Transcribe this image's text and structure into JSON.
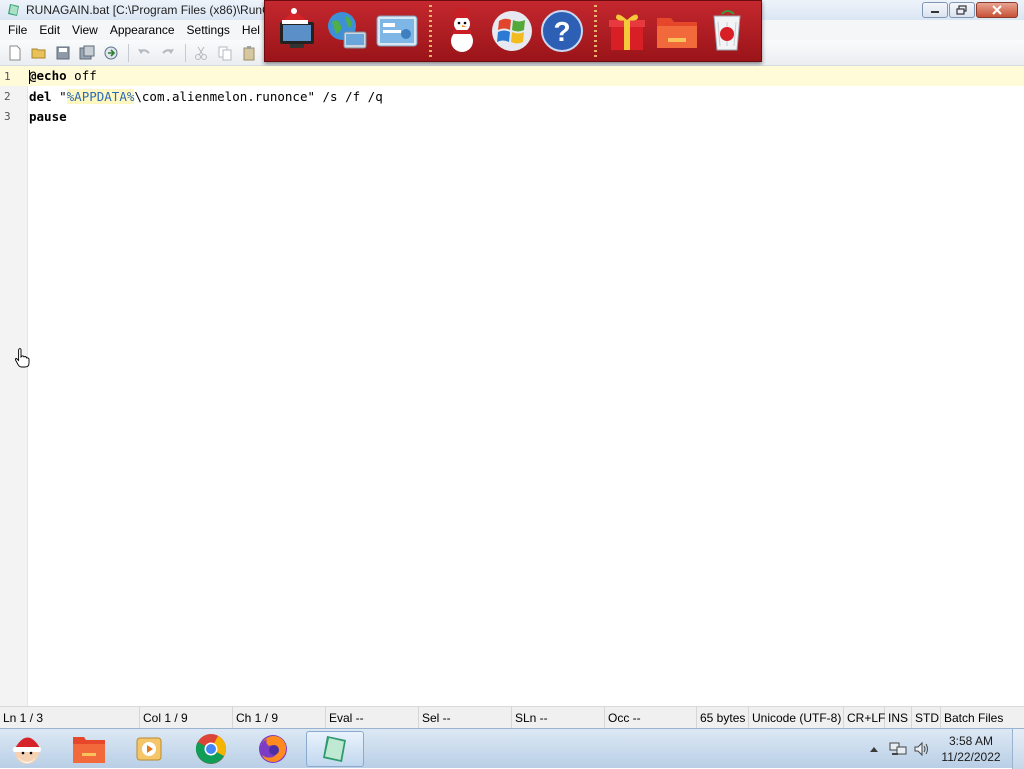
{
  "window": {
    "title": "RUNAGAIN.bat [C:\\Program Files (x86)\\RunO"
  },
  "menu": [
    "File",
    "Edit",
    "View",
    "Appearance",
    "Settings",
    "Hel"
  ],
  "toolbar": {
    "buttons": [
      "new-file-icon",
      "open-folder-icon",
      "save-icon",
      "save-as-icon",
      "browse-icon",
      "undo-icon",
      "redo-icon",
      "cut-icon",
      "copy-icon",
      "paste-icon"
    ]
  },
  "dock": {
    "icons": [
      "santa-computer-icon",
      "globe-monitor-icon",
      "control-panel-icon",
      "snowman-icon",
      "windows-logo-icon",
      "help-icon",
      "gift-box-icon",
      "folder-icon",
      "recycle-bin-icon"
    ]
  },
  "editor": {
    "lines": [
      {
        "num": "1",
        "parts": [
          {
            "t": "@echo",
            "k": "kw"
          },
          {
            "t": " off",
            "k": ""
          }
        ]
      },
      {
        "num": "2",
        "parts": [
          {
            "t": "del",
            "k": "kw"
          },
          {
            "t": " \"",
            "k": ""
          },
          {
            "t": "%APPDATA%",
            "k": "var"
          },
          {
            "t": "\\com.alienmelon.runonce\" /s /f /q",
            "k": ""
          }
        ]
      },
      {
        "num": "3",
        "parts": [
          {
            "t": "pause",
            "k": "kw"
          }
        ]
      }
    ]
  },
  "status": {
    "ln": "Ln 1 / 3",
    "col": "Col 1 / 9",
    "ch": "Ch 1 / 9",
    "eval": "Eval --",
    "sel": "Sel --",
    "sln": "SLn --",
    "occ": "Occ --",
    "size": "65 bytes",
    "encoding": "Unicode (UTF-8)",
    "eol": "CR+LF",
    "ins": "INS",
    "mode": "STD",
    "lexer": "Batch Files"
  },
  "taskbar": {
    "items": [
      "start-santa-icon",
      "folder-icon",
      "media-player-icon",
      "chrome-icon",
      "firefox-icon",
      "notepad2-icon"
    ],
    "time": "3:58 AM",
    "date": "11/22/2022"
  },
  "colors": {
    "dock_red": "#b11f25",
    "current_line": "#fffbd9",
    "variable_blue": "#2a6bb5"
  }
}
